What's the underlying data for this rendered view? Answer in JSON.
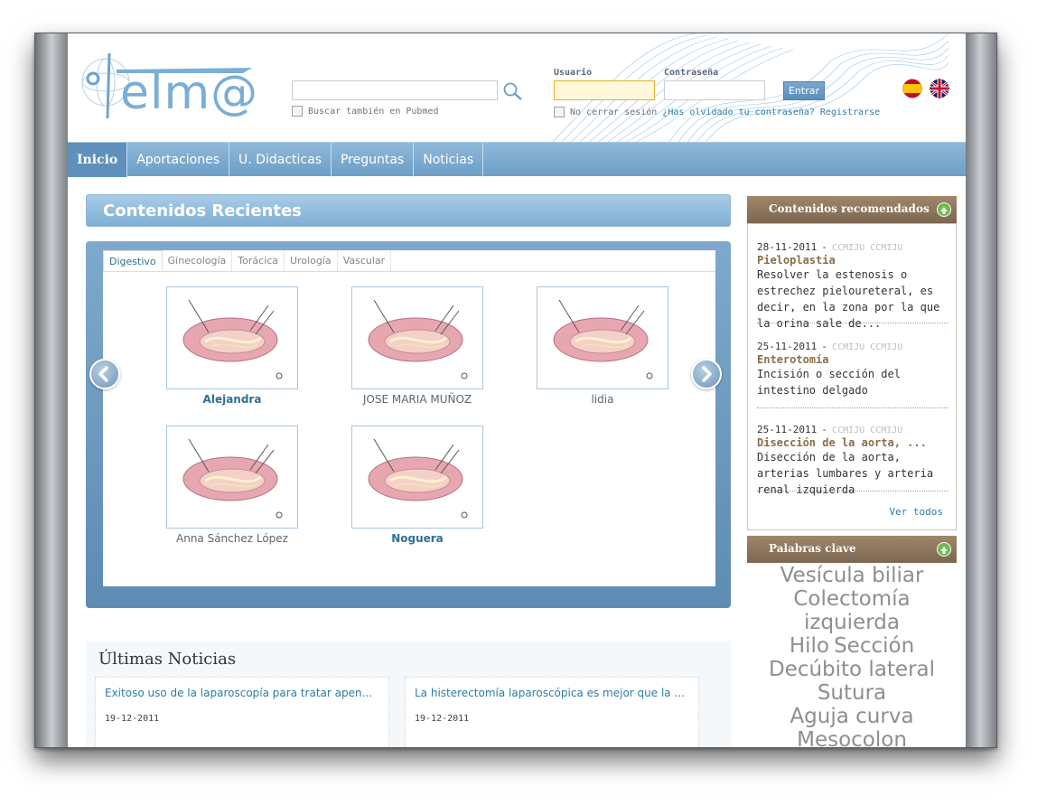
{
  "header": {
    "logo_text": "elm@",
    "search_placeholder": "",
    "pubmed_label": "Buscar también en Pubmed",
    "user_label": "Usuario",
    "password_label": "Contraseña",
    "login_button": "Entrar",
    "remember_label": "No cerrar sesión",
    "forgot_link": "¿Has olvidado tu contraseña?",
    "register_link": "Registrarse",
    "flags": [
      "spanish-flag-icon",
      "uk-flag-icon"
    ]
  },
  "nav": {
    "items": [
      "Inicio",
      "Aportaciones",
      "U. Didacticas",
      "Preguntas",
      "Noticias"
    ]
  },
  "recent": {
    "title": "Contenidos Recientes",
    "tabs": [
      "Digestivo",
      "Ginecología",
      "Torácica",
      "Urología",
      "Vascular"
    ],
    "items": [
      "Alejandra",
      "JOSE MARIA MUÑOZ",
      "lidia",
      "Anna Sánchez López",
      "Noguera"
    ]
  },
  "news": {
    "title": "Últimas Noticias",
    "items": [
      {
        "headline": "Exitoso uso de la laparoscopía para tratar apen...",
        "date": "19-12-2011"
      },
      {
        "headline": "La histerectomía laparoscópica es mejor que la ...",
        "date": "19-12-2011"
      }
    ]
  },
  "recommended": {
    "title": "Contenidos recomendados",
    "items": [
      {
        "date": "28-11-2011",
        "author": "CCMIJU CCMIJU",
        "title": "Pieloplastia",
        "desc": "Resolver la estenosis o estrechez pieloureteral, es decir, en la zona por la que la orina sale de..."
      },
      {
        "date": "25-11-2011",
        "author": "CCMIJU CCMIJU",
        "title": "Enterotomía",
        "desc": "Incisión o sección del intestino delgado"
      },
      {
        "date": "25-11-2011",
        "author": "CCMIJU CCMIJU",
        "title": "Disección de la aorta, ...",
        "desc": "Disección de la aorta, arterias lumbares y arteria renal izquierda"
      }
    ],
    "see_all": "Ver todos"
  },
  "keywords": {
    "title": "Palabras clave",
    "tags": [
      "Vesícula biliar",
      "Colectomía izquierda",
      "Hilo",
      "Sección",
      "Decúbito lateral",
      "Sutura",
      "Aguja curva",
      "Mesocolon"
    ]
  },
  "colors": {
    "nav": "#6d9ec6",
    "accent": "#2f7ca6",
    "side_header": "#8a7058"
  }
}
